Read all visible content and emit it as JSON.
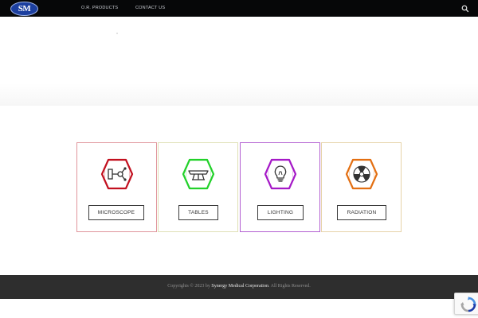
{
  "header": {
    "logo_text": "SM",
    "nav": [
      {
        "label": "O.R. PRODUCTS"
      },
      {
        "label": "CONTACT US"
      }
    ],
    "search_icon": "search-icon"
  },
  "categories": [
    {
      "label": "MICROSCOPE",
      "icon": "microscope-icon",
      "border_color": "#e0959c",
      "icon_color": "#c2101f"
    },
    {
      "label": "TABLES",
      "icon": "table-icon",
      "border_color": "#dfe0b5",
      "icon_color": "#22d12a"
    },
    {
      "label": "LIGHTING",
      "icon": "lightbulb-icon",
      "border_color": "#b35fd1",
      "icon_color": "#a519c7"
    },
    {
      "label": "RADIATION",
      "icon": "radiation-icon",
      "border_color": "#e6d3a8",
      "icon_color": "#e36f12"
    }
  ],
  "footer": {
    "copyright_prefix": "Copyrights © 2023 by ",
    "company": "Synergy Medical Corporation",
    "copyright_suffix": ". All Rights Reserved."
  },
  "recaptcha": {
    "icon": "recaptcha-icon"
  }
}
